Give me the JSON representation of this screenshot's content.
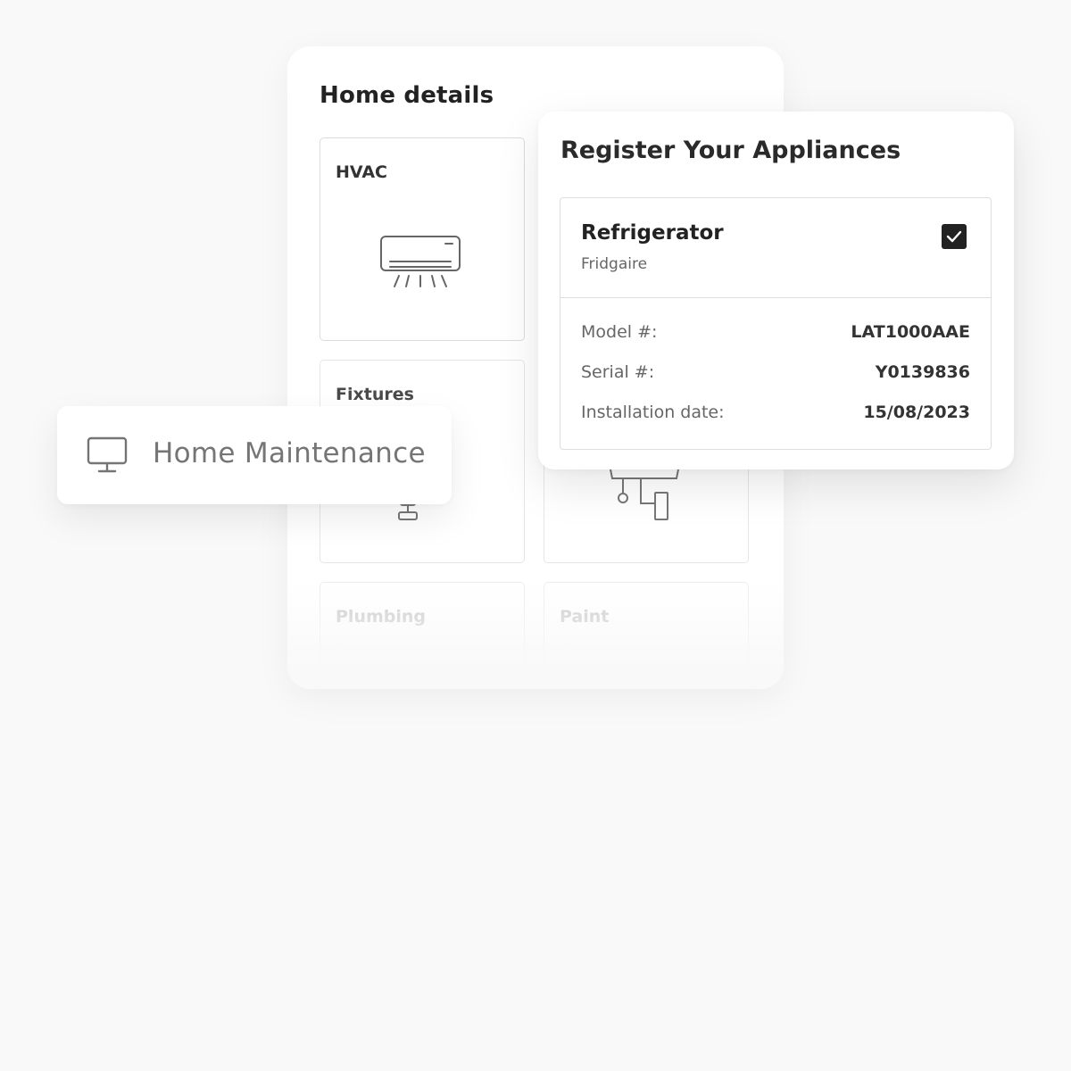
{
  "home_details": {
    "title": "Home details",
    "tiles": [
      {
        "label": "HVAC",
        "icon": "air-conditioner-icon"
      },
      {
        "label": "Fixtures",
        "icon": "faucet-icon"
      },
      {
        "label": "",
        "icon": "water-heater-icon"
      },
      {
        "label": "Plumbing",
        "icon": "pipe-icon"
      },
      {
        "label": "Paint",
        "icon": "paint-icon"
      }
    ]
  },
  "register": {
    "title": "Register Your Appliances",
    "appliance": {
      "name": "Refrigerator",
      "brand": "Fridgaire",
      "checked": true,
      "details": [
        {
          "key": "Model #:",
          "value": "LAT1000AAE"
        },
        {
          "key": "Serial #:",
          "value": "Y0139836"
        },
        {
          "key": "Installation date:",
          "value": "15/08/2023"
        }
      ]
    }
  },
  "maintenance": {
    "label": "Home Maintenance",
    "icon": "monitor-icon"
  },
  "colors": {
    "background": "#f9f9f9",
    "card": "#ffffff",
    "text_dark": "#222222",
    "text_muted": "#666666",
    "checkbox": "#222222"
  }
}
